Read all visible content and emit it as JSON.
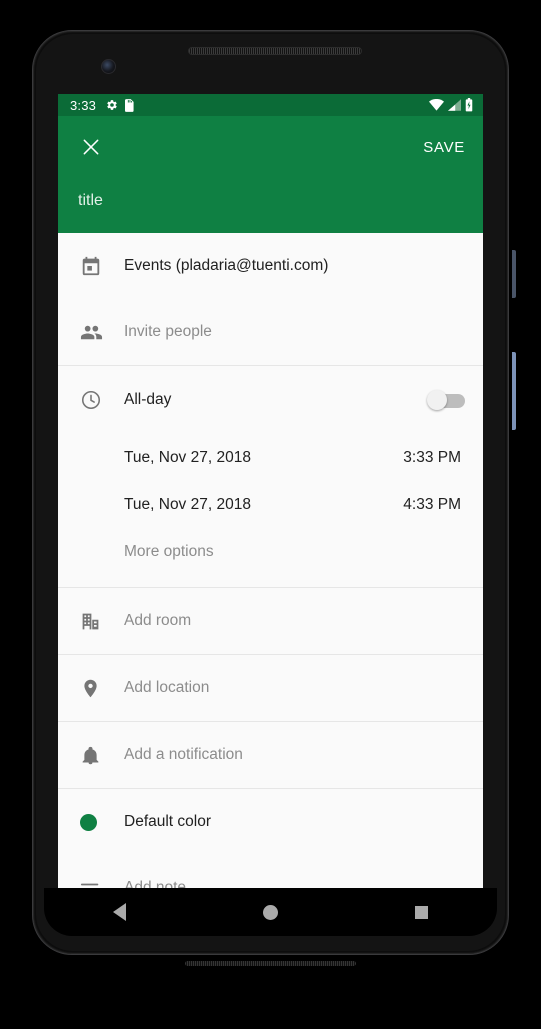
{
  "status_bar": {
    "time": "3:33",
    "left_icons": [
      "settings-gear-icon",
      "sd-card-icon"
    ],
    "right_icons": [
      "wifi-icon",
      "cell-signal-icon",
      "battery-charging-icon"
    ]
  },
  "app_bar": {
    "close_icon": "close-icon",
    "save_label": "SAVE",
    "title_placeholder": "title",
    "background_color": "#0f8043",
    "status_bar_color": "#0b6b37"
  },
  "rows": {
    "calendar": {
      "icon": "calendar-icon",
      "label": "Events (pladaria@tuenti.com)",
      "muted": false
    },
    "guests": {
      "icon": "people-icon",
      "label": "Invite people",
      "muted": true
    },
    "all_day": {
      "icon": "clock-icon",
      "label": "All-day",
      "toggle_on": false,
      "muted": false
    },
    "start": {
      "date": "Tue, Nov 27, 2018",
      "time": "3:33 PM"
    },
    "end": {
      "date": "Tue, Nov 27, 2018",
      "time": "4:33 PM"
    },
    "more_options": {
      "label": "More options",
      "muted": true
    },
    "room": {
      "icon": "building-icon",
      "label": "Add room",
      "muted": true
    },
    "location": {
      "icon": "location-pin-icon",
      "label": "Add location",
      "muted": true
    },
    "notification": {
      "icon": "bell-icon",
      "label": "Add a notification",
      "muted": true
    },
    "color": {
      "icon": "color-dot-icon",
      "label": "Default color",
      "color_value": "#0f8043",
      "muted": false
    },
    "note": {
      "icon": "notes-icon",
      "label": "Add note",
      "muted": true
    }
  },
  "nav_bar": {
    "back": "back-triangle-icon",
    "home": "home-circle-icon",
    "recents": "recents-square-icon"
  }
}
